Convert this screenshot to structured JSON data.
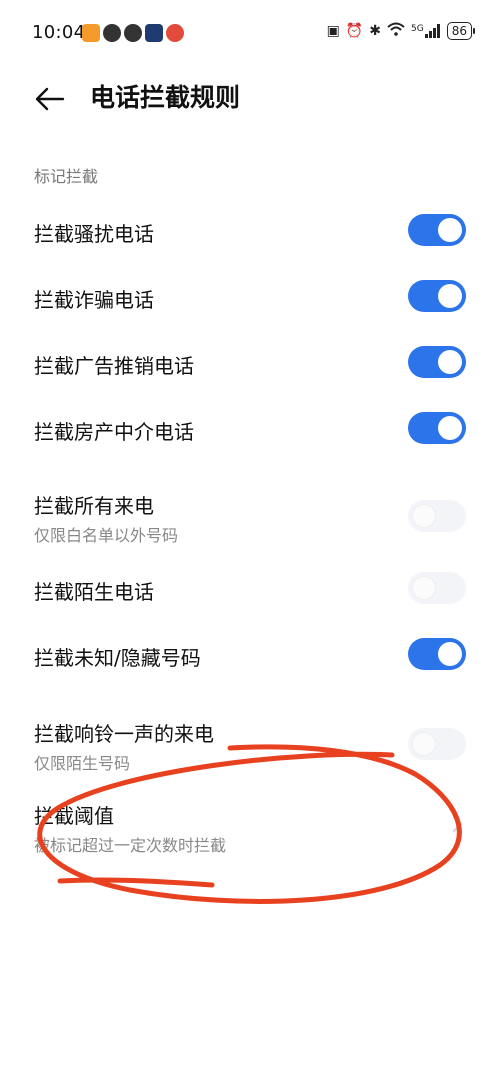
{
  "status_bar": {
    "time": "10:04",
    "network": "5G",
    "battery": "86"
  },
  "header": {
    "title": "电话拦截规则"
  },
  "section": {
    "label": "标记拦截"
  },
  "rows": [
    {
      "title": "拦截骚扰电话",
      "toggle": true
    },
    {
      "title": "拦截诈骗电话",
      "toggle": true
    },
    {
      "title": "拦截广告推销电话",
      "toggle": true
    },
    {
      "title": "拦截房产中介电话",
      "toggle": true
    },
    {
      "title": "拦截所有来电",
      "subtitle": "仅限白名单以外号码",
      "toggle": false
    },
    {
      "title": "拦截陌生电话",
      "toggle": false
    },
    {
      "title": "拦截未知/隐藏号码",
      "toggle": true
    },
    {
      "title": "拦截响铃一声的来电",
      "subtitle": "仅限陌生号码",
      "toggle": false
    },
    {
      "title": "拦截阈值",
      "subtitle": "被标记超过一定次数时拦截"
    }
  ],
  "colors": {
    "accent": "#2c74ea",
    "annotation": "#e8411f"
  }
}
